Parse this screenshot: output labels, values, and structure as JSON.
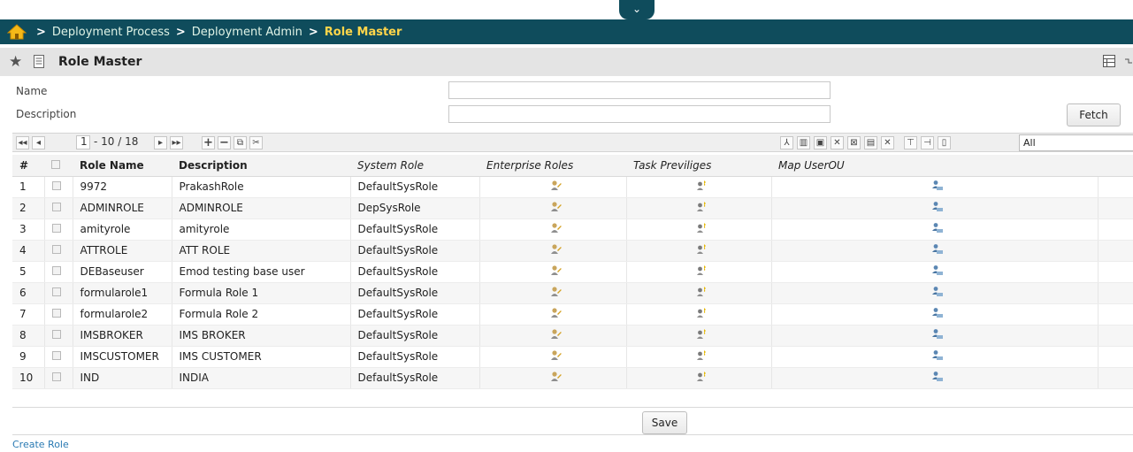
{
  "breadcrumb": {
    "items": [
      "Deployment Process",
      "Deployment Admin"
    ],
    "current": "Role Master",
    "separator": ">"
  },
  "page": {
    "title": "Role Master"
  },
  "filters": {
    "name_label": "Name",
    "description_label": "Description",
    "fetch_label": "Fetch"
  },
  "pager": {
    "current_page": "1",
    "range_text": "- 10 / 18",
    "filter_value": "All"
  },
  "table": {
    "columns": {
      "index": "#",
      "role_name": "Role Name",
      "description": "Description",
      "system_role": "System Role",
      "enterprise_roles": "Enterprise Roles",
      "task_privileges": "Task Previliges",
      "map_userou": "Map UserOU"
    },
    "rows": [
      {
        "idx": "1",
        "name": "9972",
        "desc": "PrakashRole",
        "sys": "DefaultSysRole"
      },
      {
        "idx": "2",
        "name": "ADMINROLE",
        "desc": "ADMINROLE",
        "sys": "DepSysRole"
      },
      {
        "idx": "3",
        "name": "amityrole",
        "desc": "amityrole",
        "sys": "DefaultSysRole"
      },
      {
        "idx": "4",
        "name": "ATTROLE",
        "desc": "ATT ROLE",
        "sys": "DefaultSysRole"
      },
      {
        "idx": "5",
        "name": "DEBaseuser",
        "desc": "Emod testing base user",
        "sys": "DefaultSysRole"
      },
      {
        "idx": "6",
        "name": "formularole1",
        "desc": "Formula Role 1",
        "sys": "DefaultSysRole"
      },
      {
        "idx": "7",
        "name": "formularole2",
        "desc": "Formula Role 2",
        "sys": "DefaultSysRole"
      },
      {
        "idx": "8",
        "name": "IMSBROKER",
        "desc": "IMS BROKER",
        "sys": "DefaultSysRole"
      },
      {
        "idx": "9",
        "name": "IMSCUSTOMER",
        "desc": "IMS CUSTOMER",
        "sys": "DefaultSysRole"
      },
      {
        "idx": "10",
        "name": "IND",
        "desc": "INDIA",
        "sys": "DefaultSysRole"
      }
    ]
  },
  "footer": {
    "save_label": "Save",
    "create_link": "Create Role"
  },
  "colors": {
    "topbar": "#0f4c5c",
    "breadcrumb_current": "#ffd54a",
    "link": "#2a7ab3"
  },
  "icons": {
    "home": "home-icon",
    "favorite": "star-icon",
    "page": "document-icon",
    "enterprise_roles": "user-edit-icon",
    "task_privileges": "user-key-icon",
    "map_userou": "user-group-icon"
  }
}
